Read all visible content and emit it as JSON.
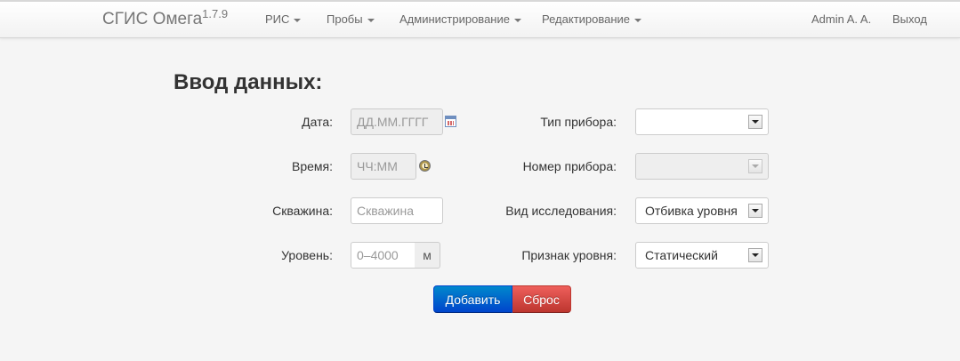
{
  "nav": {
    "brand": "СГИС Омега",
    "version": "1.7.9",
    "menu": [
      "РИС",
      "Пробы",
      "Администрирование",
      "Редактирование"
    ],
    "user": "Admin A. A.",
    "logout": "Выход"
  },
  "form": {
    "title": "Ввод данных:",
    "date": {
      "label": "Дата:",
      "placeholder": "ДД.ММ.ГГГГ"
    },
    "time": {
      "label": "Время:",
      "placeholder": "ЧЧ:ММ"
    },
    "well": {
      "label": "Скважина:",
      "placeholder": "Скважина"
    },
    "level": {
      "label": "Уровень:",
      "placeholder": "0–4000",
      "unit": "м"
    },
    "device_type": {
      "label": "Тип прибора:",
      "value": ""
    },
    "device_number": {
      "label": "Номер прибора:",
      "value": ""
    },
    "study_type": {
      "label": "Вид исследования:",
      "value": "Отбивка уровня"
    },
    "level_sign": {
      "label": "Признак уровня:",
      "value": "Статический"
    },
    "add_button": "Добавить",
    "reset_button": "Сброс"
  }
}
